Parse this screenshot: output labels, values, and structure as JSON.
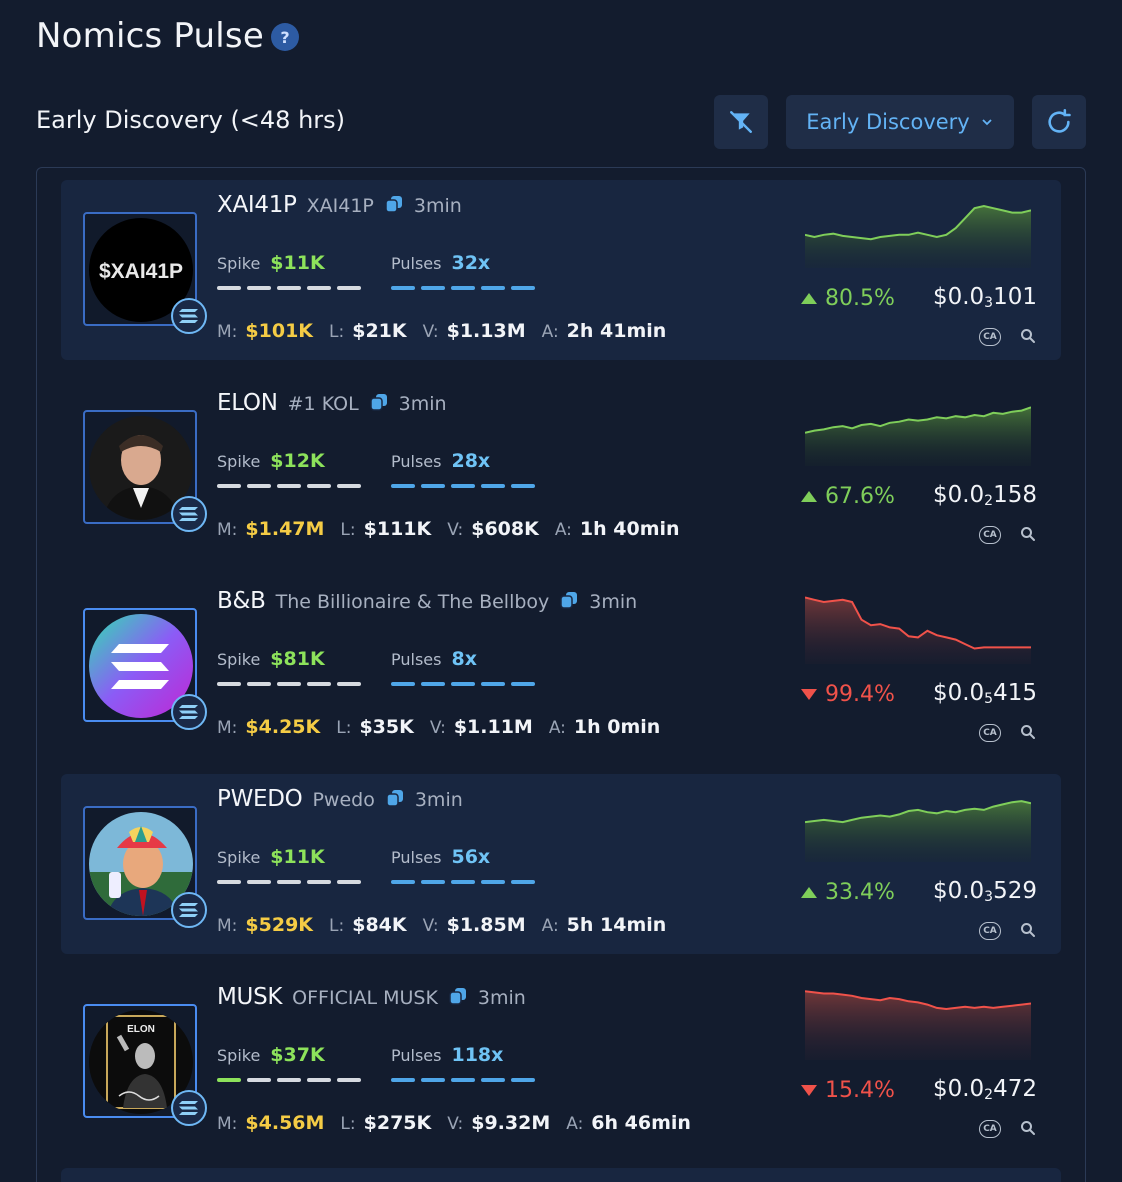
{
  "header": {
    "title": "Nomics Pulse",
    "help_icon": "question-icon",
    "section_title": "Early Discovery (<48 hrs)",
    "filter_icon": "filter-off-icon",
    "dropdown_label": "Early Discovery",
    "refresh_icon": "refresh-icon"
  },
  "labels": {
    "spike": "Spike",
    "pulses": "Pulses",
    "m": "M:",
    "l": "L:",
    "v": "V:",
    "a": "A:",
    "ca": "CA"
  },
  "colors": {
    "background": "#131c2e",
    "card_alt": "#182640",
    "accent_blue": "#63b3f5",
    "up_green": "#7fce5a",
    "down_red": "#f0524a",
    "mcap_yellow": "#f5cc45"
  },
  "tokens": [
    {
      "ticker": "XAI41P",
      "name": "XAI41P",
      "age": "3min",
      "spike": "$11K",
      "pulses": "32x",
      "spike_level": 0,
      "mcap": "$101K",
      "liquidity": "$21K",
      "volume": "$1.13M",
      "token_age": "2h 41min",
      "change": "80.5%",
      "direction": "up",
      "price_prefix": "$0.0",
      "price_zeros": "3",
      "price_digits": "101",
      "avatar_text": "$XAI41P",
      "spark": [
        30,
        28,
        30,
        31,
        29,
        28,
        27,
        26,
        28,
        29,
        30,
        30,
        32,
        30,
        28,
        30,
        36,
        45,
        54,
        56,
        54,
        52,
        50,
        50,
        52
      ]
    },
    {
      "ticker": "ELON",
      "name": "#1 KOL",
      "age": "3min",
      "spike": "$12K",
      "pulses": "28x",
      "spike_level": 0,
      "mcap": "$1.47M",
      "liquidity": "$111K",
      "volume": "$608K",
      "token_age": "1h 40min",
      "change": "67.6%",
      "direction": "up",
      "price_prefix": "$0.0",
      "price_zeros": "2",
      "price_digits": "158",
      "avatar_text": "",
      "spark": [
        30,
        32,
        33,
        35,
        36,
        34,
        37,
        38,
        36,
        39,
        40,
        42,
        41,
        42,
        44,
        43,
        45,
        44,
        46,
        45,
        48,
        47,
        49,
        50,
        53
      ]
    },
    {
      "ticker": "B&B",
      "name": "The Billionaire & The Bellboy",
      "age": "3min",
      "spike": "$81K",
      "pulses": "8x",
      "spike_level": 0,
      "mcap": "$4.25K",
      "liquidity": "$35K",
      "volume": "$1.11M",
      "token_age": "1h 0min",
      "change": "99.4%",
      "direction": "down",
      "price_prefix": "$0.0",
      "price_zeros": "5",
      "price_digits": "415",
      "avatar_text": "",
      "spark": [
        60,
        58,
        56,
        57,
        58,
        56,
        40,
        35,
        36,
        33,
        32,
        25,
        24,
        30,
        26,
        24,
        22,
        18,
        14,
        15,
        15,
        15,
        15,
        15,
        15
      ]
    },
    {
      "ticker": "PWEDO",
      "name": "Pwedo",
      "age": "3min",
      "spike": "$11K",
      "pulses": "56x",
      "spike_level": 0,
      "mcap": "$529K",
      "liquidity": "$84K",
      "volume": "$1.85M",
      "token_age": "5h 14min",
      "change": "33.4%",
      "direction": "up",
      "price_prefix": "$0.0",
      "price_zeros": "3",
      "price_digits": "529",
      "avatar_text": "",
      "spark": [
        36,
        37,
        38,
        37,
        36,
        38,
        40,
        41,
        42,
        41,
        43,
        46,
        47,
        45,
        44,
        46,
        45,
        47,
        48,
        47,
        50,
        52,
        54,
        55,
        53
      ]
    },
    {
      "ticker": "MUSK",
      "name": "OFFICIAL MUSK",
      "age": "3min",
      "spike": "$37K",
      "pulses": "118x",
      "spike_level": 1,
      "mcap": "$4.56M",
      "liquidity": "$275K",
      "volume": "$9.32M",
      "token_age": "6h 46min",
      "change": "15.4%",
      "direction": "down",
      "price_prefix": "$0.0",
      "price_zeros": "2",
      "price_digits": "472",
      "avatar_text": "ELON",
      "spark": [
        62,
        61,
        60,
        60,
        59,
        58,
        56,
        55,
        54,
        56,
        55,
        53,
        52,
        50,
        47,
        46,
        47,
        48,
        47,
        48,
        47,
        48,
        49,
        50,
        51
      ]
    }
  ]
}
